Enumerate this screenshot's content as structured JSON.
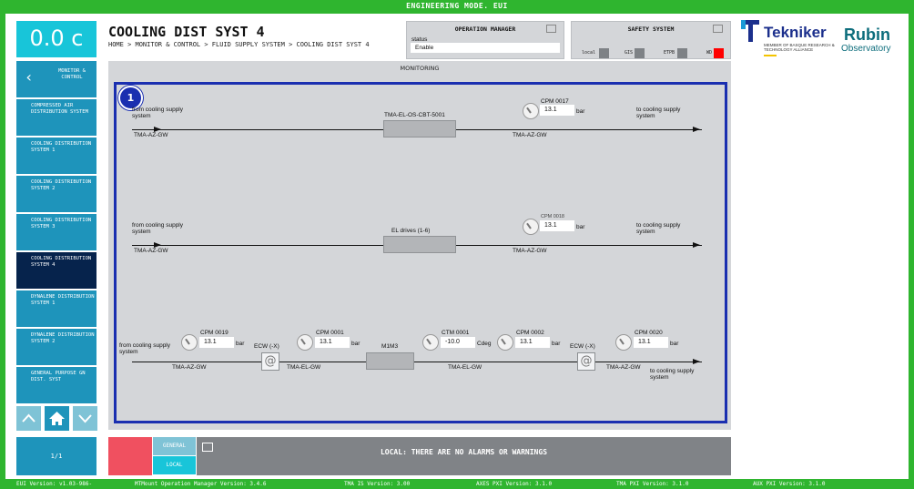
{
  "header": {
    "mode": "ENGINEERING MODE. EUI"
  },
  "temperature": "0.0 c",
  "sidebar": {
    "back_label": "MONITOR & CONTROL",
    "items": [
      "COMPRESSED AIR DISTRIBUTION SYSTEM",
      "COOLING DISTRIBUTION SYSTEM 1",
      "COOLING DISTRIBUTION SYSTEM 2",
      "COOLING DISTRIBUTION SYSTEM 3",
      "COOLING DISTRIBUTION SYSTEM 4",
      "DYNALENE DISTRIBUTION SYSTEM 1",
      "DYNALENE DISTRIBUTION SYSTEM 2",
      "GENERAL PURPOSE GN DIST. SYST"
    ],
    "page": "1/1"
  },
  "page": {
    "title": "COOLING DIST SYST 4",
    "breadcrumb": "HOME > MONITOR & CONTROL > FLUID SUPPLY SYSTEM > COOLING DIST SYST 4"
  },
  "operation_manager": {
    "title": "OPERATION MANAGER",
    "status_label": "status",
    "status_value": "Enable"
  },
  "safety_system": {
    "title": "SAFETY SYSTEM",
    "items": [
      "local",
      "GIS",
      "ETPB",
      "WD"
    ],
    "colors": [
      "#7e8286",
      "#7e8286",
      "#7e8286",
      "#ff0000"
    ]
  },
  "logos": {
    "tekniker": "Tekniker",
    "tekniker_sub": "MEMBER OF BASQUE RESEARCH & TECHNOLOGY ALLIANCE",
    "rubin_1": "Rubin",
    "rubin_2": "Observatory"
  },
  "monitoring": {
    "title": "MONITORING",
    "badge": "1",
    "line1": {
      "from": "from cooling supply system",
      "gw_left": "TMA-AZ-GW",
      "component": "TMA-EL-OS-CBT-5001",
      "sensor_name": "CPM 0017",
      "value": "13.1",
      "unit": "bar",
      "gw_right": "TMA-AZ-GW",
      "to": "to cooling supply system"
    },
    "line2": {
      "from": "from cooling supply system",
      "gw_left": "TMA-AZ-GW",
      "component": "EL drives (1-6)",
      "sensor_name": "CPM 0018",
      "value": "13.1",
      "unit": "bar",
      "gw_right": "TMA-AZ-GW",
      "to": "to cooling supply system"
    },
    "line3": {
      "from": "from cooling supply system",
      "to": "to cooling supply system",
      "component": "M1M3",
      "sensors": [
        {
          "name": "CPM 0019",
          "value": "13.1",
          "unit": "bar"
        },
        {
          "name": "CPM 0001",
          "value": "13.1",
          "unit": "bar"
        },
        {
          "name": "CTM 0001",
          "value": "-10.0",
          "unit": "Cdeg"
        },
        {
          "name": "CPM 0002",
          "value": "13.1",
          "unit": "bar"
        },
        {
          "name": "CPM 0020",
          "value": "13.1",
          "unit": "bar"
        }
      ],
      "valves": [
        "ECW (-X)",
        "ECW (-X)"
      ],
      "gws": [
        "TMA-AZ-GW",
        "TMA-EL-GW",
        "TMA-EL-GW",
        "TMA-AZ-GW"
      ]
    }
  },
  "alarms": {
    "tabs": [
      "GENERAL",
      "LOCAL"
    ],
    "message": "LOCAL: THERE ARE NO ALARMS OR WARNINGS"
  },
  "footer": {
    "eui": "EUI Version: v1.03-986-",
    "mtmount": "MTMount Operation Manager Version: 3.4.6",
    "tma_is": "TMA IS Version: 3.00",
    "axes": "AXES PXI Version: 3.1.0",
    "tma_pxi": "TMA PXI Version: 3.1.0",
    "aux": "AUX PXI Version: 3.1.0"
  }
}
